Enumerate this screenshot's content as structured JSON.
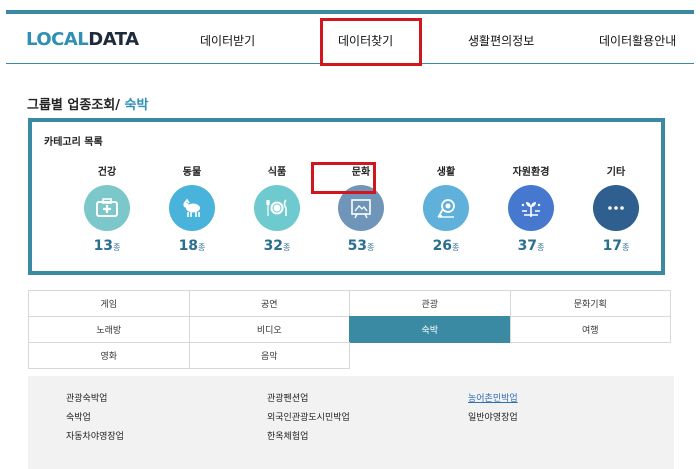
{
  "logo": {
    "local": "LOCAL",
    "data": "DATA"
  },
  "nav": [
    {
      "label": "데이터받기"
    },
    {
      "label": "데이터찾기"
    },
    {
      "label": "생활편의정보"
    },
    {
      "label": "데이터활용안내"
    }
  ],
  "page_title": {
    "prefix": "그룹별 업종조회/",
    "current": "숙박"
  },
  "category_list": {
    "title": "카테고리 목록",
    "unit": "종",
    "items": [
      {
        "label": "건강",
        "count": "13",
        "color": "#7cc7c9",
        "icon": "first-aid-kit-icon"
      },
      {
        "label": "동물",
        "count": "18",
        "color": "#49b3dc",
        "icon": "goat-icon"
      },
      {
        "label": "식품",
        "count": "32",
        "color": "#6fcad0",
        "icon": "plate-fork-knife-icon"
      },
      {
        "label": "문화",
        "count": "53",
        "color": "#6f95b8",
        "icon": "culture-frame-icon"
      },
      {
        "label": "생활",
        "count": "26",
        "color": "#5fb0da",
        "icon": "hairdryer-icon"
      },
      {
        "label": "자원환경",
        "count": "37",
        "color": "#4778cf",
        "icon": "recycle-plant-icon"
      },
      {
        "label": "기타",
        "count": "17",
        "color": "#2f5f8f",
        "icon": "more-dots-icon"
      }
    ]
  },
  "subcategories": [
    [
      "게임",
      "공연",
      "관광",
      "문화기획"
    ],
    [
      "노래방",
      "비디오",
      "숙박",
      "여행"
    ],
    [
      "영화",
      "음악",
      "",
      ""
    ]
  ],
  "active_subcategory": "숙박",
  "business_types": [
    [
      "관광숙박업",
      "관광펜션업",
      "농어촌민박업"
    ],
    [
      "숙박업",
      "외국인관광도시민박업",
      "일반야영장업"
    ],
    [
      "자동차야영장업",
      "한옥체험업",
      ""
    ]
  ],
  "colors": {
    "accent": "#3a8aa3",
    "highlight": "#d2161d"
  }
}
